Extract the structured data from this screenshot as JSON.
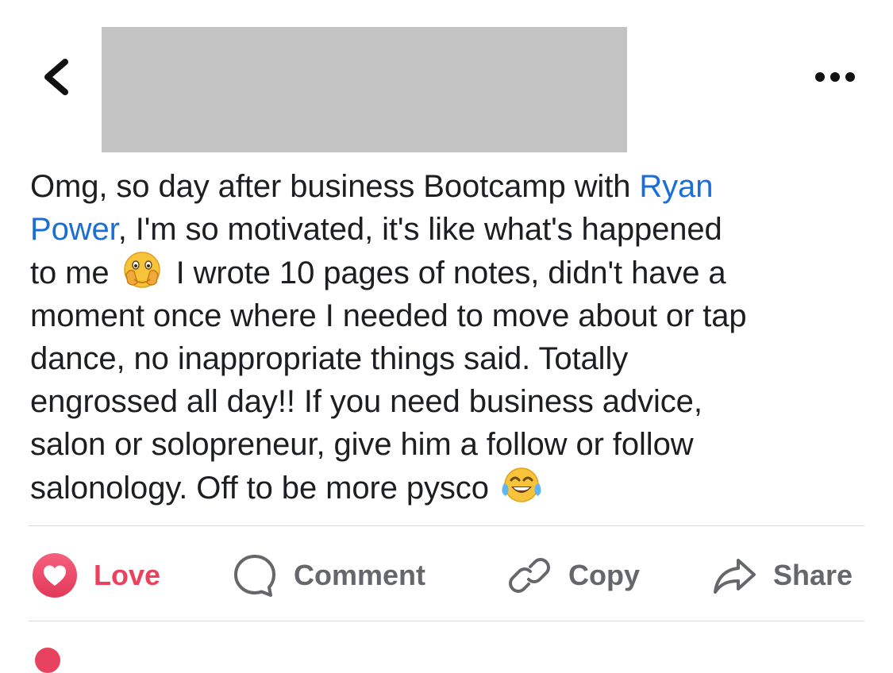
{
  "header": {
    "back_icon": "chevron-left-icon",
    "more_icon": "ellipsis-icon"
  },
  "post": {
    "line1_prefix": "Omg, so day after business Bootcamp with ",
    "mention_part1": "Ryan",
    "mention_part2": "Power",
    "line2_suffix": ", I'm so motivated, it's like what's happened",
    "line3_prefix": "to me",
    "line3_suffix": "I wrote 10 pages of notes, didn't have a",
    "line4": "moment once where I needed to move about or tap",
    "line5": "dance, no inappropriate things said. Totally",
    "line6": "engrossed all day!! If you need business advice,",
    "line7": "salon or solopreneur, give him a follow or follow",
    "line8": "salonology. Off to be more pysco",
    "emoji1": "face-with-open-eyes-and-hand-over-mouth",
    "emoji2": "face-with-tears-of-joy"
  },
  "actions": {
    "love": "Love",
    "comment": "Comment",
    "copy": "Copy",
    "share": "Share"
  },
  "colors": {
    "mention": "#1a6ed8",
    "love": "#e8425f",
    "action_gray": "#65676b",
    "redaction": "#c3c3c3"
  }
}
